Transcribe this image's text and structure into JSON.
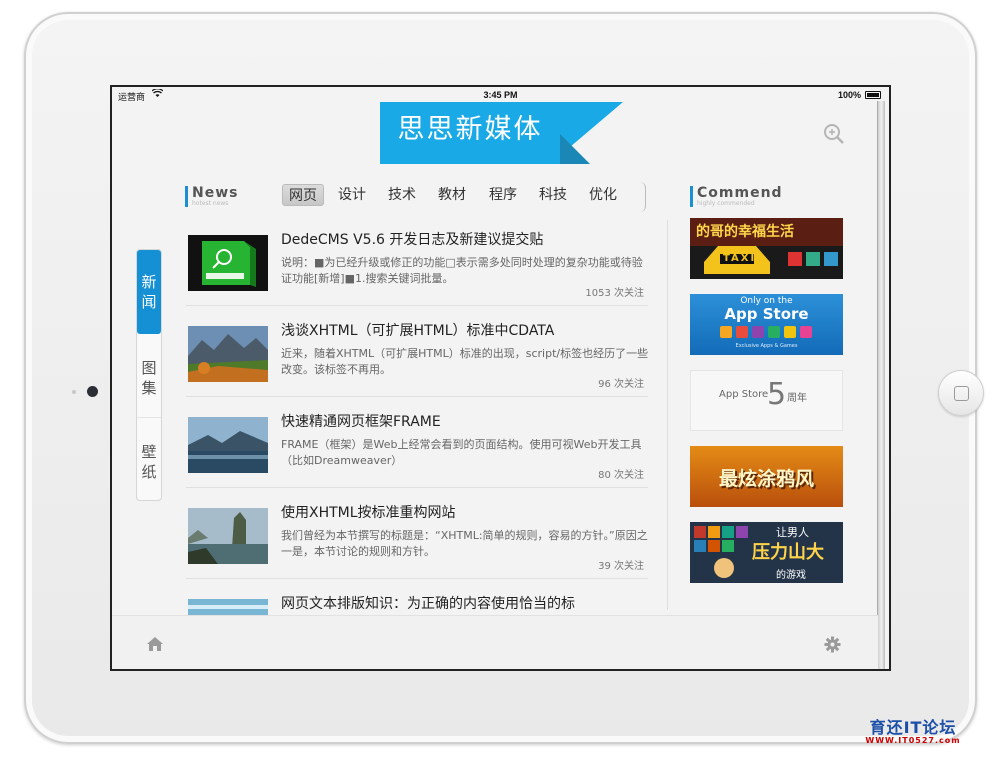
{
  "status_bar": {
    "carrier": "运营商",
    "time": "3:45 PM",
    "battery": "100%"
  },
  "logo_text": "思思新媒体",
  "news_section": {
    "title": "News",
    "subtitle": "hotest news"
  },
  "tabs": [
    "网页",
    "设计",
    "技术",
    "教材",
    "程序",
    "科技",
    "优化"
  ],
  "side_nav": [
    "新闻",
    "图集",
    "壁纸"
  ],
  "articles": [
    {
      "title": "DedeCMS V5.6 开发日志及新建议提交贴",
      "desc": "说明：■为已经升级或修正的功能□表示需多处同时处理的复杂功能或待验证功能[新增]■1.搜索关键词批量。",
      "count": "1053 次关注"
    },
    {
      "title": "浅谈XHTML（可扩展HTML）标准中CDATA",
      "desc": "近来，随着XHTML（可扩展HTML）标准的出现，script/标签也经历了一些改变。该标签不再用。",
      "count": "96 次关注"
    },
    {
      "title": "快速精通网页框架FRAME",
      "desc": "FRAME（框架）是Web上经常会看到的页面结构。使用可视Web开发工具（比如Dreamweaver）",
      "count": "80 次关注"
    },
    {
      "title": "使用XHTML按标准重构网站",
      "desc": "我们曾经为本节撰写的标题是：“XHTML:简单的规则，容易的方针。”原因之一是，本节讨论的规则和方针。",
      "count": "39 次关注"
    },
    {
      "title": "网页文本排版知识：为正确的内容使用恰当的标",
      "desc": "",
      "count": ""
    }
  ],
  "commend_section": {
    "title": "Commend",
    "subtitle": "highly commended"
  },
  "ads": [
    {
      "text": "的哥的幸福生活",
      "sub": "TAXI"
    },
    {
      "text": "App Store",
      "sub": "Only on the",
      "small": "Exclusive Apps & Games"
    },
    {
      "text": "App Store",
      "num": "5",
      "sub": "周年"
    },
    {
      "text": "最炫涂鸦风"
    },
    {
      "text": "压力山大",
      "sub": "让男人",
      "small": "的游戏"
    }
  ],
  "watermark": {
    "line1": "育还IT论坛",
    "line2": "WWW.IT0527.com"
  },
  "colors": {
    "accent": "#1590d4",
    "logo_blue": "#19a9e6"
  }
}
